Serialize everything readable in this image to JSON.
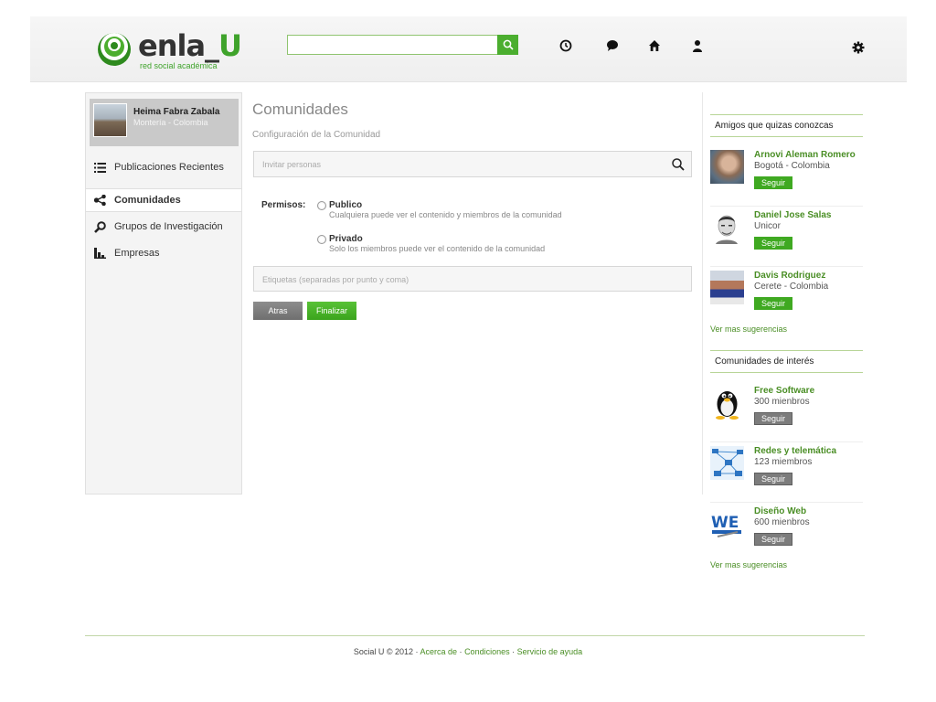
{
  "header": {
    "logo_text_a": "enla_",
    "logo_text_b": "U",
    "logo_sub": "red social académica",
    "search_value": "",
    "icons": [
      "search-icon",
      "history-icon",
      "chat-icon",
      "home-icon",
      "user-icon",
      "gear-icon"
    ]
  },
  "profile": {
    "name": "Heima Fabra Zabala",
    "location": "Montería - Colombia"
  },
  "nav": [
    {
      "label": "Publicaciones Recientes",
      "icon": "list-icon"
    },
    {
      "label": "Comunidades",
      "icon": "share-icon",
      "active": true
    },
    {
      "label": "Grupos de Investigación",
      "icon": "magnifier-icon"
    },
    {
      "label": "Empresas",
      "icon": "bar-chart-icon"
    }
  ],
  "main": {
    "title": "Comunidades",
    "subtitle": "Configuración de la Comunidad",
    "invite_placeholder": "Invitar personas",
    "permissions_label": "Permisos:",
    "options": [
      {
        "title": "Publico",
        "desc": "Cualquiera puede ver el contenido y miembros de la comunidad"
      },
      {
        "title": "Privado",
        "desc": "Solo los miembros puede ver el contenido de la comunidad"
      }
    ],
    "tags_placeholder": "Etiquetas (separadas por  punto y coma)",
    "back_label": "Atras",
    "finish_label": "Finalizar"
  },
  "friends": {
    "title": "Amigos que quizas conozcas",
    "items": [
      {
        "name": "Arnovi Aleman Romero",
        "sub": "Bogotá - Colombia",
        "button": "Seguir"
      },
      {
        "name": "Daniel Jose Salas",
        "sub": "Unicor",
        "button": "Seguir"
      },
      {
        "name": "Davis Rodriguez",
        "sub": "Cerete  - Colombia",
        "button": "Seguir"
      }
    ],
    "more": "Ver mas sugerencias"
  },
  "communities": {
    "title": "Comunidades de interés",
    "items": [
      {
        "name": "Free Software",
        "sub": "300 mienbros",
        "button": "Seguir"
      },
      {
        "name": "Redes y telemática",
        "sub": "123 miembros",
        "button": "Seguir"
      },
      {
        "name": "Diseño Web",
        "sub": "600 mienbros",
        "button": "Seguir"
      }
    ],
    "more": "Ver mas sugerencias"
  },
  "footer": {
    "copyright": "Social U © 2012 ·",
    "links": [
      "Acerca de",
      "Condiciones",
      "Servicio de ayuda"
    ],
    "sep": "·"
  },
  "colors": {
    "accent": "#3fa921",
    "link": "#4a8e25",
    "border": "#b8d597"
  }
}
